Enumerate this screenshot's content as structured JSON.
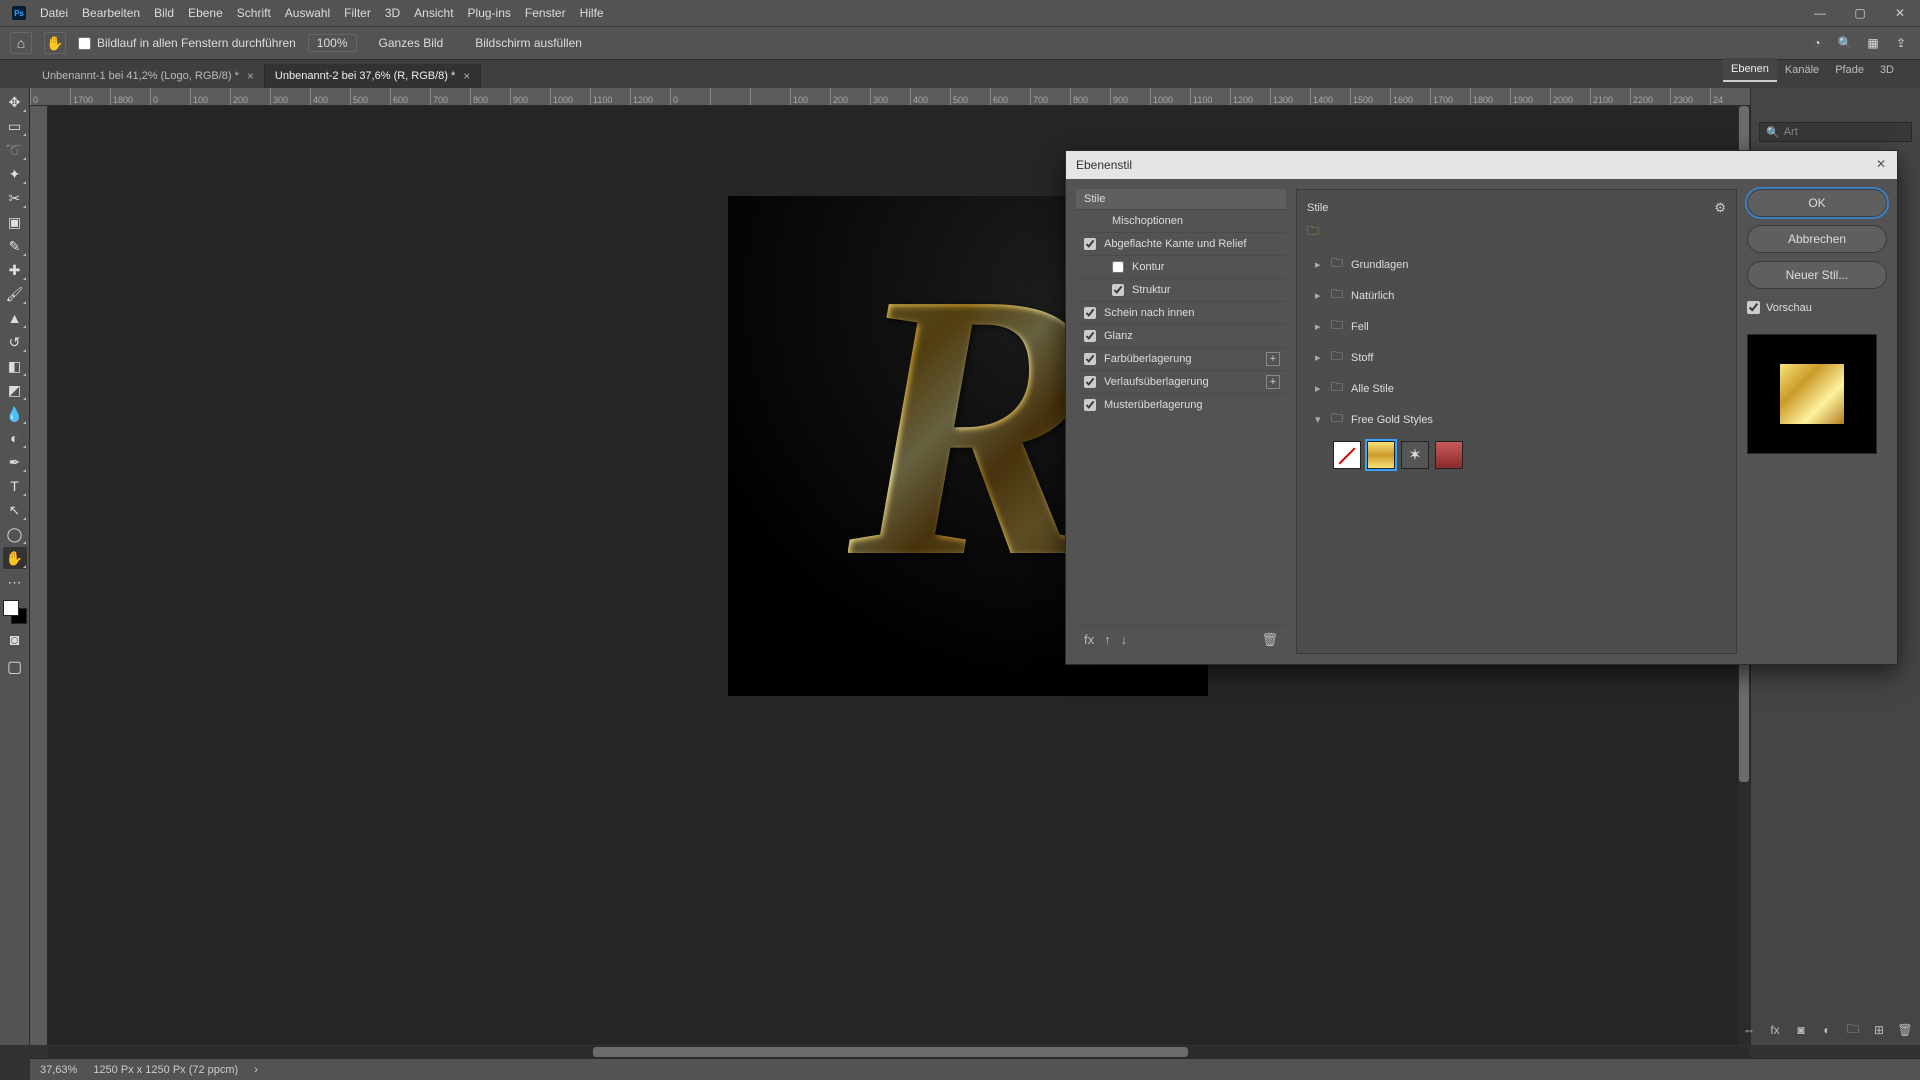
{
  "menu": [
    "Datei",
    "Bearbeiten",
    "Bild",
    "Ebene",
    "Schrift",
    "Auswahl",
    "Filter",
    "3D",
    "Ansicht",
    "Plug-ins",
    "Fenster",
    "Hilfe"
  ],
  "optbar": {
    "scroll_all": "Bildlauf in allen Fenstern durchführen",
    "zoom_value": "100%",
    "fit_whole": "Ganzes Bild",
    "fill_screen": "Bildschirm ausfüllen"
  },
  "tabs": [
    {
      "title": "Unbenannt-1 bei 41,2% (Logo, RGB/8) *",
      "active": false
    },
    {
      "title": "Unbenannt-2 bei 37,6% (R, RGB/8) *",
      "active": true
    }
  ],
  "panel_tabs": [
    "Ebenen",
    "Kanäle",
    "Pfade",
    "3D"
  ],
  "panel_active_tab": 0,
  "search_placeholder": "Art",
  "ruler_ticks": [
    "0",
    "1700",
    "1800",
    "0",
    "100",
    "200",
    "300",
    "400",
    "500",
    "600",
    "700",
    "800",
    "900",
    "1000",
    "1100",
    "1200",
    "0",
    "",
    "",
    "100",
    "200",
    "300",
    "400",
    "500",
    "600",
    "700",
    "800",
    "900",
    "1000",
    "1100",
    "1200",
    "1300",
    "1400",
    "1500",
    "1600",
    "1700",
    "1800",
    "1900",
    "2000",
    "2100",
    "2200",
    "2300",
    "24"
  ],
  "glyph": "R",
  "status": {
    "zoom": "37,63%",
    "docinfo": "1250 Px x 1250 Px (72 ppcm)"
  },
  "dialog": {
    "title": "Ebenenstil",
    "left": {
      "header": "Stile",
      "blend": "Mischoptionen",
      "items": [
        {
          "label": "Abgeflachte Kante und Relief",
          "checked": true,
          "indent": 0
        },
        {
          "label": "Kontur",
          "checked": false,
          "indent": 1
        },
        {
          "label": "Struktur",
          "checked": true,
          "indent": 1
        },
        {
          "label": "Schein nach innen",
          "checked": true,
          "indent": 0
        },
        {
          "label": "Glanz",
          "checked": true,
          "indent": 0
        },
        {
          "label": "Farbüberlagerung",
          "checked": true,
          "indent": 0,
          "plus": true
        },
        {
          "label": "Verlaufsüberlagerung",
          "checked": true,
          "indent": 0,
          "plus": true
        },
        {
          "label": "Musterüberlagerung",
          "checked": true,
          "indent": 0
        }
      ]
    },
    "mid": {
      "header": "Stile",
      "folders": [
        {
          "name": "Grundlagen",
          "open": false
        },
        {
          "name": "Natürlich",
          "open": false
        },
        {
          "name": "Fell",
          "open": false
        },
        {
          "name": "Stoff",
          "open": false
        },
        {
          "name": "Alle Stile",
          "open": false
        },
        {
          "name": "Free Gold Styles",
          "open": true
        }
      ],
      "swatches": [
        "none",
        "gold",
        "splat",
        "red"
      ],
      "selected_swatch": 1
    },
    "right": {
      "ok": "OK",
      "cancel": "Abbrechen",
      "newstyle": "Neuer Stil...",
      "preview": "Vorschau"
    }
  },
  "tools": [
    "move",
    "rect-select",
    "lasso",
    "magic-wand",
    "crop",
    "frame",
    "eyedropper",
    "heal",
    "brush",
    "stamp",
    "history-brush",
    "eraser",
    "gradient",
    "blur",
    "dodge",
    "pen",
    "type",
    "path-select",
    "ellipse",
    "hand"
  ]
}
